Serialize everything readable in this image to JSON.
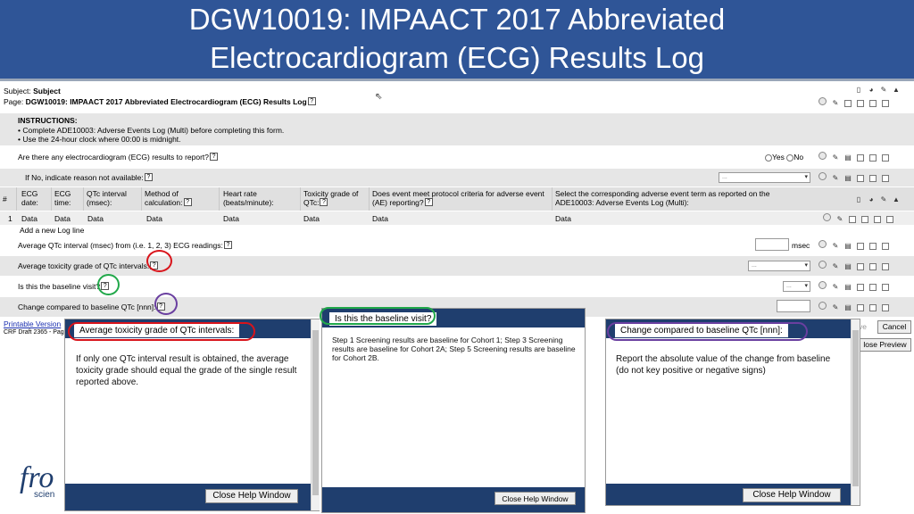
{
  "slide": {
    "title_line1": "DGW10019: IMPAACT 2017 Abbreviated",
    "title_line2": "Electrocardiogram (ECG) Results Log"
  },
  "form": {
    "subject_label": "Subject:",
    "subject_value": "Subject",
    "page_label": "Page:",
    "page_value": "DGW10019: IMPAACT 2017 Abbreviated Electrocardiogram (ECG) Results Log",
    "instructions_title": "INSTRUCTIONS:",
    "instructions_line1": "• Complete ADE10003: Adverse Events Log (Multi) before completing this form.",
    "instructions_line2": "• Use the 24-hour clock where 00:00 is midnight.",
    "q_ecg": "Are there any electrocardiogram (ECG) results to report?",
    "yes_label": "Yes",
    "no_label": "No",
    "q_reason": "If No, indicate reason not available:",
    "select_placeholder": "...",
    "table_headers": {
      "num": "#",
      "ecg_date": "ECG date:",
      "ecg_time": "ECG time:",
      "qtc_interval": "QTc interval (msec):",
      "method": "Method of calculation:",
      "heart_rate": "Heart rate (beats/minute):",
      "toxicity": "Toxicity grade of QTc:",
      "protocol": "Does event meet protocol criteria for adverse event (AE) reporting?",
      "ae_term": "Select the corresponding adverse event term as reported on the ADE10003: Adverse Events Log (Multi):"
    },
    "row1": {
      "num": "1",
      "ecg_date": "Data",
      "ecg_time": "Data",
      "qtc_interval": "Data",
      "method": "Data",
      "heart_rate": "Data",
      "toxicity": "Data",
      "protocol": "Data",
      "ae_term": "Data"
    },
    "add_log_line": "Add a new Log line",
    "q_avg_qtc": "Average QTc interval (msec) from (i.e. 1, 2, 3) ECG readings:",
    "msec_unit": "msec",
    "q_avg_tox": "Average toxicity grade of QTc intervals:",
    "q_baseline": "Is this the baseline visit?",
    "q_change": "Change compared to baseline QTc [nnn]:",
    "printable_version": "Printable Version",
    "crf_draft": "CRF Draft 2365 - Pag",
    "save_partial": "ve",
    "cancel_label": "Cancel",
    "close_preview_label": "lose Preview"
  },
  "help_windows": [
    {
      "title": "Average toxicity grade of QTc intervals:",
      "body": "If only one QTc interval result is obtained, the average toxicity grade should equal the grade of the single result reported above.",
      "close_label": "Close Help Window"
    },
    {
      "title": "Is this the baseline visit?",
      "body": "Step 1 Screening results are baseline for Cohort 1; Step 3 Screening results are baseline for Cohort 2A; Step 5 Screening results are baseline for Cohort 2B.",
      "close_label": "Close Help Window"
    },
    {
      "title": "Change compared to baseline QTc [nnn]:",
      "body": "Report the absolute value of the change from baseline (do not key positive or negative signs)",
      "close_label": "Close Help Window"
    }
  ],
  "logo_text": {
    "fro": "fro",
    "scien": "scien"
  },
  "colors": {
    "title_band": "#2f5597",
    "help_header": "#1f3e6e",
    "annotation_red": "#d9141b",
    "annotation_green": "#21a84a",
    "annotation_purple": "#6a3fa0",
    "link_blue": "#1a2fb0"
  }
}
